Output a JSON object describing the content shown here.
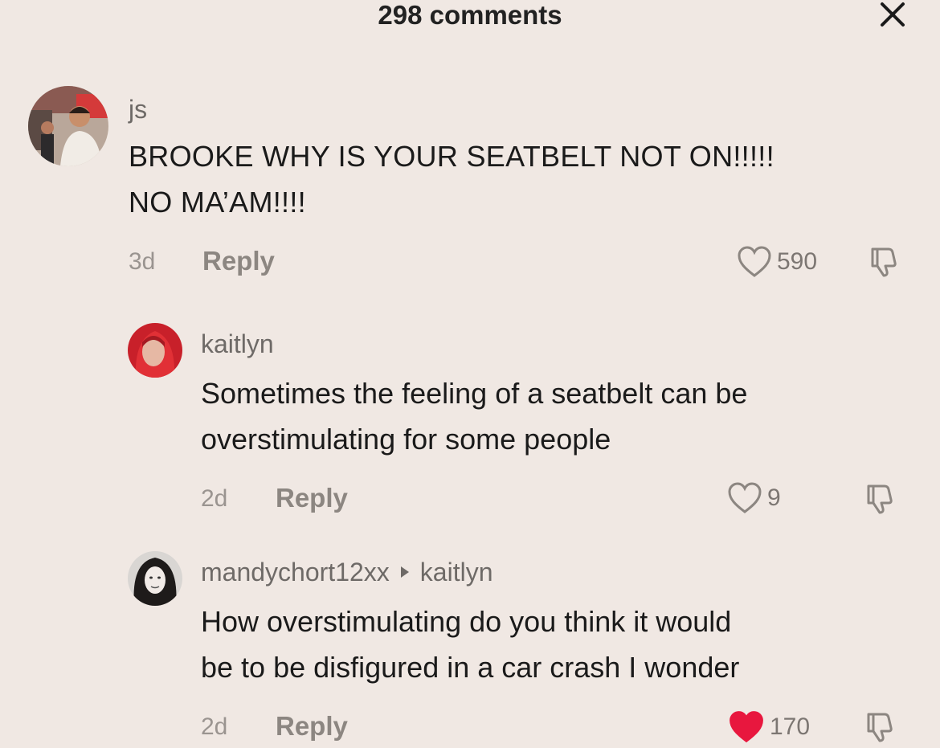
{
  "header": {
    "title": "298 comments",
    "close_icon": "close-icon"
  },
  "comments": [
    {
      "username": "js",
      "text_lines": [
        "BROOKE WHY IS YOUR SEATBELT NOT ON!!!!!",
        "NO MA’AM!!!!"
      ],
      "time": "3d",
      "reply_label": "Reply",
      "likes": "590",
      "liked": false
    },
    {
      "username": "kaitlyn",
      "text_lines": [
        "Sometimes the feeling of a seatbelt can be",
        "overstimulating for some people"
      ],
      "time": "2d",
      "reply_label": "Reply",
      "likes": "9",
      "liked": false
    },
    {
      "username": "mandychort12xx",
      "reply_to": "kaitlyn",
      "text_lines": [
        "How overstimulating do you think it would",
        "be to be disfigured in a car crash I wonder"
      ],
      "time": "2d",
      "reply_label": "Reply",
      "likes": "170",
      "liked": true
    }
  ],
  "colors": {
    "background": "#f0e8e3",
    "liked_heart": "#e8173e",
    "muted_text": "#8c8681"
  }
}
